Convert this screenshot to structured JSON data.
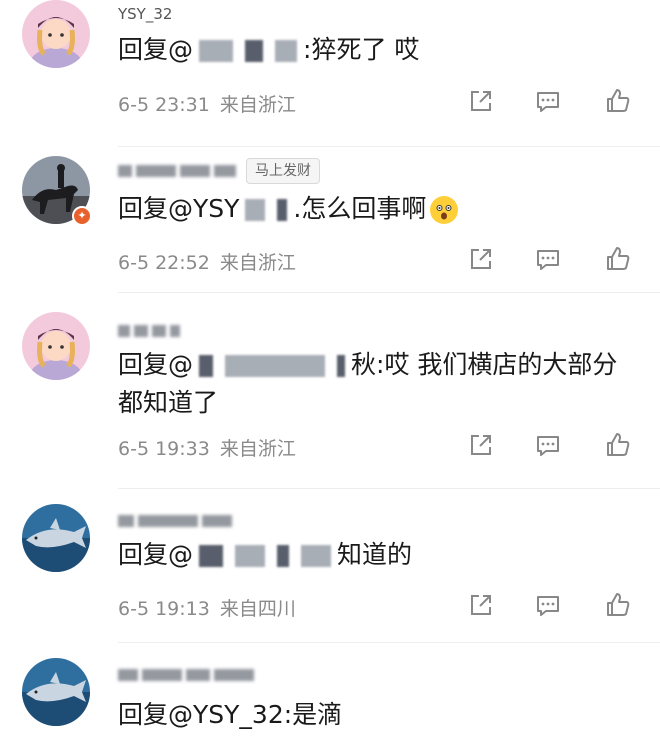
{
  "comments": [
    {
      "username": "YSY_32",
      "reply_prefix": "回复@",
      "reply_text": ":猝死了 哎",
      "date": "6-5 23:31",
      "location": "来自浙江",
      "avatar": "girl-cap-avatar"
    },
    {
      "username": "",
      "badge": "马上发财",
      "reply_prefix": "回复@YSY",
      "reply_text": ".怎么回事啊",
      "emoji": "astonished-face-icon",
      "date": "6-5 22:52",
      "location": "来自浙江",
      "avatar": "horse-rider-avatar"
    },
    {
      "username": "",
      "reply_prefix": "回复@",
      "reply_mid": "秋",
      "reply_text": ":哎 我们横店的大部分都知道了",
      "date": "6-5 19:33",
      "location": "来自浙江",
      "avatar": "girl-cap-avatar"
    },
    {
      "username": "",
      "reply_prefix": "回复@",
      "reply_text": "知道的",
      "date": "6-5 19:13",
      "location": "来自四川",
      "avatar": "shark-avatar"
    },
    {
      "username": "",
      "reply_prefix": "回复@YSY_32:",
      "reply_text": "是滴",
      "avatar": "shark-avatar"
    }
  ],
  "icons": {
    "share": "share-icon",
    "comment": "comment-icon",
    "like": "thumbs-up-icon"
  },
  "colors": {
    "meta": "#8a8a8a",
    "badge_bg": "#e8602c"
  }
}
